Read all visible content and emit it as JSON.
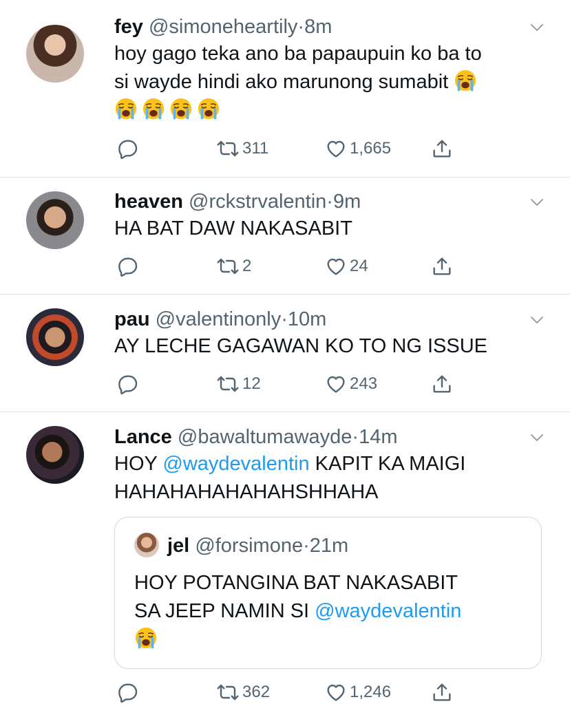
{
  "tweets": [
    {
      "name": "fey",
      "handle": "@simoneheartily",
      "sep": "·",
      "time": "8m",
      "text_line1": "hoy gago teka ano ba papaupuin ko ba to",
      "text_line2": "si wayde hindi ako marunong sumabit",
      "emoji": "loudly-crying-face",
      "retweets": "311",
      "likes": "1,665"
    },
    {
      "name": "heaven",
      "handle": "@rckstrvalentin",
      "sep": "·",
      "time": "9m",
      "text": "HA BAT DAW NAKASABIT",
      "retweets": "2",
      "likes": "24"
    },
    {
      "name": "pau",
      "handle": "@valentinonly",
      "sep": "·",
      "time": "10m",
      "text": "AY LECHE GAGAWAN KO TO NG ISSUE",
      "retweets": "12",
      "likes": "243"
    },
    {
      "name": "Lance",
      "handle": "@bawaltumawayde",
      "sep": "·",
      "time": "14m",
      "text_pre": "HOY ",
      "mention": "@waydevalentin",
      "text_post": " KAPIT KA MAIGI",
      "text_line2": "HAHAHAHAHAHAHSHHAHA",
      "retweets": "362",
      "likes": "1,246",
      "quote": {
        "name": "jel",
        "handle": "@forsimone",
        "sep": "·",
        "time": "21m",
        "text_line1": "HOY POTANGINA BAT NAKASABIT",
        "text_line2_pre": "SA JEEP NAMIN SI ",
        "mention": "@waydevalentin"
      }
    }
  ],
  "colors": {
    "text": "#0f1419",
    "secondary": "#536471",
    "link": "#1d9bf0",
    "divider": "#dfe3e7"
  },
  "icons": [
    "reply-icon",
    "retweet-icon",
    "like-icon",
    "share-icon",
    "chevron-down-icon",
    "loudly-crying-face-emoji"
  ]
}
